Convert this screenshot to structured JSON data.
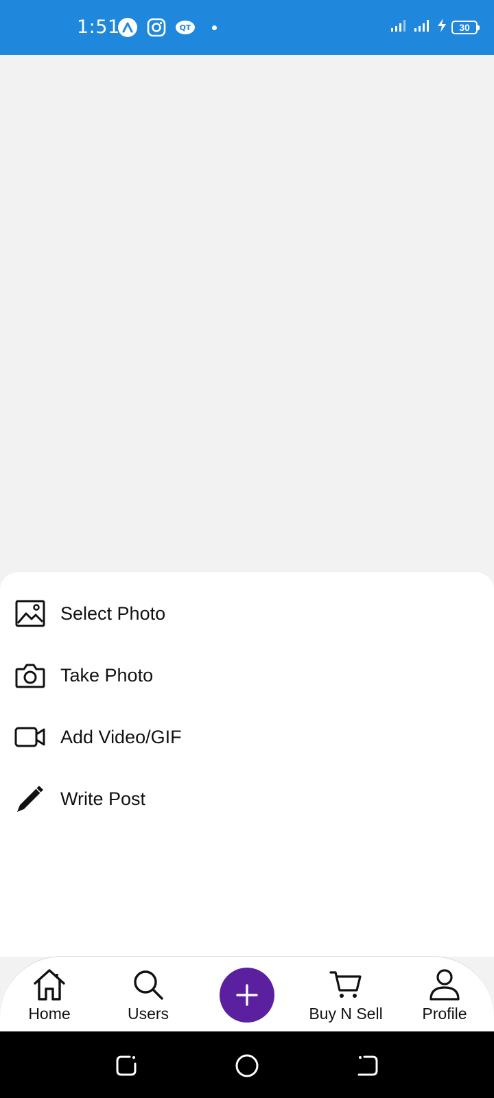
{
  "status_bar": {
    "time": "1:51",
    "battery": "30",
    "left_icons": [
      "app-a-icon",
      "instagram-icon",
      "qt-icon"
    ],
    "right_icons": [
      "signal-1-icon",
      "signal-2-icon",
      "charging-icon",
      "battery-icon"
    ]
  },
  "sheet": {
    "items": [
      {
        "label": "Select Photo",
        "icon": "image-icon"
      },
      {
        "label": "Take Photo",
        "icon": "camera-icon"
      },
      {
        "label": "Add Video/GIF",
        "icon": "video-icon"
      },
      {
        "label": "Write Post",
        "icon": "pencil-icon"
      }
    ]
  },
  "nav": {
    "items": [
      {
        "label": "Home",
        "icon": "home-icon"
      },
      {
        "label": "Users",
        "icon": "search-icon"
      },
      {
        "label": "Buy N Sell",
        "icon": "cart-icon"
      },
      {
        "label": "Profile",
        "icon": "user-icon"
      }
    ],
    "fab_icon": "plus-icon",
    "fab_color": "#5a20a0"
  },
  "system_nav": [
    "recents-icon",
    "home-circle-icon",
    "back-icon"
  ],
  "colors": {
    "status_bar": "#1f88dc",
    "background": "#f2f2f2",
    "sheet": "#ffffff"
  }
}
